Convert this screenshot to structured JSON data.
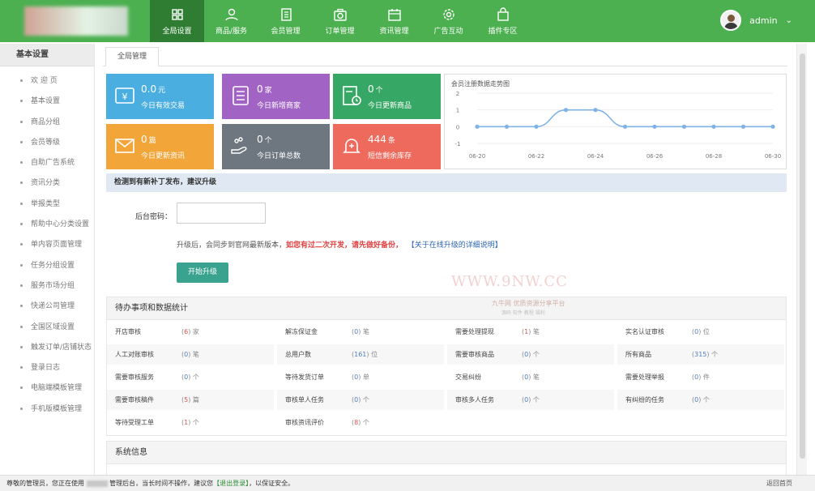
{
  "nav": {
    "items": [
      {
        "label": "全局设置",
        "icon": "grid-icon"
      },
      {
        "label": "商品/服务",
        "icon": "user-icon"
      },
      {
        "label": "会员管理",
        "icon": "document-icon"
      },
      {
        "label": "订单管理",
        "icon": "camera-icon"
      },
      {
        "label": "资讯管理",
        "icon": "calendar-icon"
      },
      {
        "label": "广告互动",
        "icon": "gear-icon"
      },
      {
        "label": "插件专区",
        "icon": "bag-icon"
      }
    ],
    "active_index": 0,
    "user": "admin"
  },
  "sidebar": {
    "title": "基本设置",
    "items": [
      "欢 迎 页",
      "基本设置",
      "商品分组",
      "会员等级",
      "自助广告系统",
      "资讯分类",
      "举报类型",
      "帮助中心分类设置",
      "单内容页面管理",
      "任务分组设置",
      "服务市场分组",
      "快递公司管理",
      "全国区域设置",
      "触发订单/店铺状态",
      "登录日志",
      "电脑端模板管理",
      "手机版模板管理"
    ]
  },
  "tab": {
    "label": "全局管理"
  },
  "cards": [
    {
      "value": "0.0",
      "unit": "元",
      "label": "今日有效交易",
      "color": "#4aaee0",
      "icon": "money-icon"
    },
    {
      "value": "0",
      "unit": "家",
      "label": "今日新增商家",
      "color": "#a264c4",
      "icon": "list-icon"
    },
    {
      "value": "0",
      "unit": "个",
      "label": "今日更新商品",
      "color": "#37a765",
      "icon": "clock-doc-icon"
    },
    {
      "value": "0",
      "unit": "篇",
      "label": "今日更新资讯",
      "color": "#f2a63a",
      "icon": "mail-icon"
    },
    {
      "value": "0",
      "unit": "个",
      "label": "今日订单总数",
      "color": "#6e7780",
      "icon": "hand-icon"
    },
    {
      "value": "444",
      "unit": "条",
      "label": "短信剩余库存",
      "color": "#ee6a5c",
      "icon": "bell-icon"
    }
  ],
  "chart_data": {
    "type": "line",
    "title": "会员注册数据走势图",
    "x": [
      "06-20",
      "06-21",
      "06-22",
      "06-23",
      "06-24",
      "06-25",
      "06-26",
      "06-27",
      "06-28",
      "06-29",
      "06-30"
    ],
    "values": [
      0,
      0,
      0,
      1,
      1,
      0,
      0,
      0,
      0,
      0,
      0
    ],
    "xticks": [
      "06-20",
      "06-22",
      "06-24",
      "06-26",
      "06-28",
      "06-30"
    ],
    "yticks": [
      2,
      1,
      0,
      -1
    ],
    "ylim": [
      -1,
      2
    ],
    "color": "#7fb2e6",
    "grid": true
  },
  "update": {
    "banner": "检测到有新补丁发布，建议升级",
    "password_label": "后台密码：",
    "note_prefix": "升级后，会同步到官网最新版本，",
    "note_warn": "如您有过二次开发，请先做好备份，",
    "note_link": "【关于在线升级的详细说明】",
    "button": "开始升级"
  },
  "watermark": {
    "text": "WWW.9NW.CC",
    "sub": "九牛网 优质资源分享平台",
    "sub2": "源码 软件 教程 福利"
  },
  "stats": {
    "title": "待办事项和数据统计",
    "rows": [
      [
        {
          "k": "开店审核",
          "v": "6",
          "u": "家",
          "red": true
        },
        {
          "k": "解冻保证金",
          "v": "0",
          "u": "笔"
        },
        {
          "k": "需要处理提现",
          "v": "1",
          "u": "笔",
          "red": true
        },
        {
          "k": "实名认证审核",
          "v": "0",
          "u": "位"
        }
      ],
      [
        {
          "k": "人工对账审核",
          "v": "0",
          "u": "笔"
        },
        {
          "k": "总用户数",
          "v": "161",
          "u": "位"
        },
        {
          "k": "需要审核商品",
          "v": "0",
          "u": "个"
        },
        {
          "k": "所有商品",
          "v": "315",
          "u": "个"
        }
      ],
      [
        {
          "k": "需要审核服务",
          "v": "0",
          "u": "个"
        },
        {
          "k": "等待发货订单",
          "v": "0",
          "u": "单"
        },
        {
          "k": "交易纠纷",
          "v": "0",
          "u": "笔"
        },
        {
          "k": "需要处理举报",
          "v": "0",
          "u": "件"
        }
      ],
      [
        {
          "k": "需要审核稿件",
          "v": "5",
          "u": "篇",
          "red": true
        },
        {
          "k": "审核单人任务",
          "v": "0",
          "u": "个"
        },
        {
          "k": "审核多人任务",
          "v": "0",
          "u": "个"
        },
        {
          "k": "有纠纷的任务",
          "v": "0",
          "u": "个"
        }
      ],
      [
        {
          "k": "等待受理工单",
          "v": "1",
          "u": "个",
          "red": true
        },
        {
          "k": "审核资讯评价",
          "v": "8",
          "u": "个",
          "red": true
        }
      ]
    ]
  },
  "system": {
    "title": "系统信息"
  },
  "footer": {
    "msg_a": "尊敬的管理员，您正在使用",
    "msg_b": "管理后台，当长时间不操作，建议您",
    "logout": "【退出登录】",
    "msg_c": "，以保证安全。",
    "home": "返回首页"
  }
}
